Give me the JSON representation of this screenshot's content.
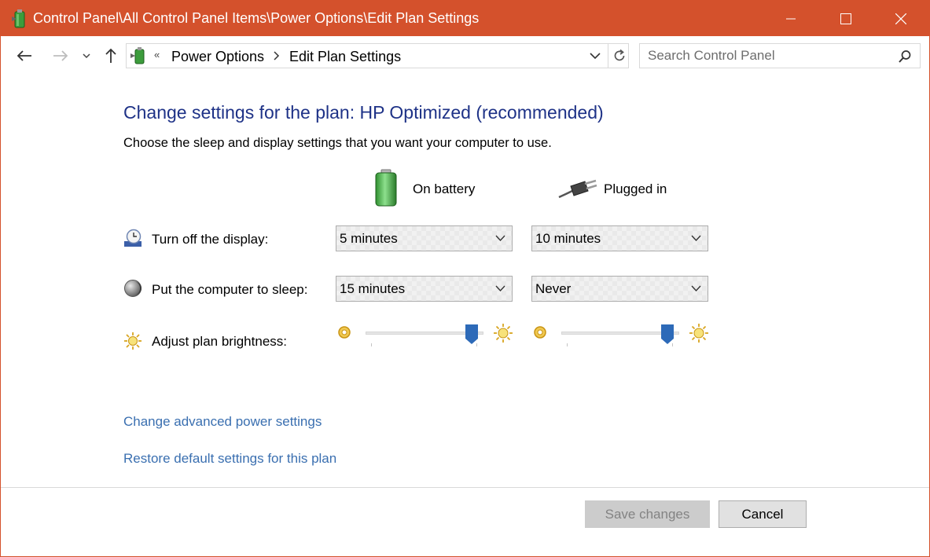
{
  "window": {
    "title": "Control Panel\\All Control Panel Items\\Power Options\\Edit Plan Settings",
    "accent_color": "#d4512c"
  },
  "address_bar": {
    "overflow_chevron": "«",
    "crumbs": [
      "Power Options",
      "Edit Plan Settings"
    ]
  },
  "search": {
    "placeholder": "Search Control Panel"
  },
  "main": {
    "heading": "Change settings for the plan: HP Optimized (recommended)",
    "subtext": "Choose the sleep and display settings that you want your computer to use.",
    "columns": {
      "battery": "On battery",
      "plugged": "Plugged in"
    },
    "rows": {
      "display": {
        "label": "Turn off the display:",
        "battery": "5 minutes",
        "plugged": "10 minutes"
      },
      "sleep": {
        "label": "Put the computer to sleep:",
        "battery": "15 minutes",
        "plugged": "Never"
      },
      "brightness": {
        "label": "Adjust plan brightness:",
        "battery_level": 0.95,
        "plugged_level": 0.95
      }
    }
  },
  "links": {
    "advanced": "Change advanced power settings",
    "restore": "Restore default settings for this plan"
  },
  "buttons": {
    "save": "Save changes",
    "cancel": "Cancel"
  },
  "icons": [
    "power-options-icon",
    "back-icon",
    "forward-icon",
    "recent-dropdown-icon",
    "up-icon",
    "refresh-icon",
    "search-icon",
    "battery-icon",
    "plug-icon",
    "clock-icon",
    "sleep-moon-icon",
    "brightness-icon"
  ],
  "colors": {
    "heading": "#1e3287",
    "link": "#3a6fb0",
    "slider_thumb": "#2d6ab8"
  }
}
